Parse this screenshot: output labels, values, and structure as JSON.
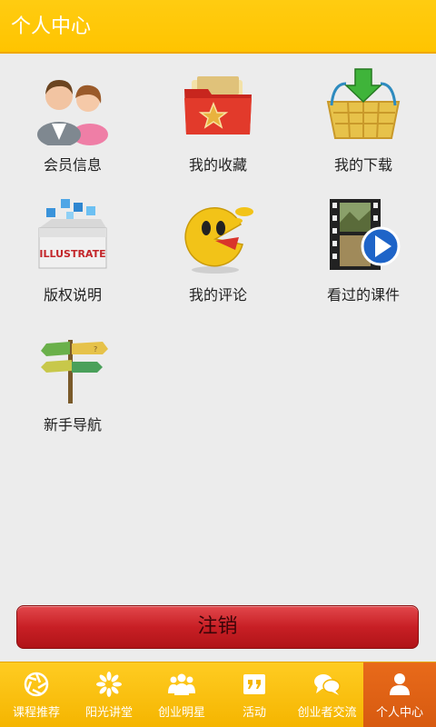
{
  "header": {
    "title": "个人中心"
  },
  "grid": {
    "items": [
      {
        "label": "会员信息",
        "icon": "members-icon"
      },
      {
        "label": "我的收藏",
        "icon": "favorites-folder-icon"
      },
      {
        "label": "我的下载",
        "icon": "download-basket-icon"
      },
      {
        "label": "版权说明",
        "icon": "copyright-box-icon"
      },
      {
        "label": "我的评论",
        "icon": "comment-smiley-icon"
      },
      {
        "label": "看过的课件",
        "icon": "video-play-icon"
      },
      {
        "label": "新手导航",
        "icon": "signpost-icon"
      }
    ],
    "copyright_icon_text": "ILLUSTRATE"
  },
  "logout": {
    "label": "注销"
  },
  "tabbar": {
    "tabs": [
      {
        "label": "课程推荐",
        "icon": "aperture-icon"
      },
      {
        "label": "阳光讲堂",
        "icon": "sun-flower-icon"
      },
      {
        "label": "创业明星",
        "icon": "people-icon"
      },
      {
        "label": "活动",
        "icon": "quote-icon"
      },
      {
        "label": "创业者交流",
        "icon": "chat-bubbles-icon"
      },
      {
        "label": "个人中心",
        "icon": "user-icon"
      }
    ],
    "active": "个人中心"
  },
  "colors": {
    "header": "#ffc400",
    "logout": "#c81f25",
    "active_tab": "#e0621a"
  }
}
